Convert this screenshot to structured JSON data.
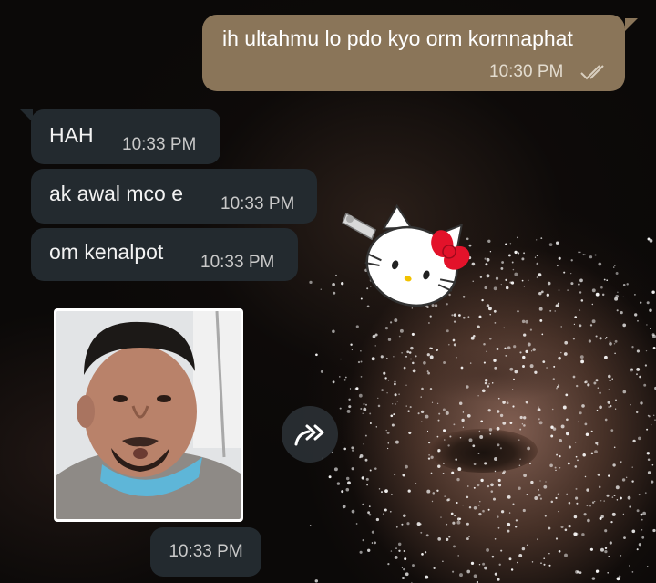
{
  "messages": [
    {
      "direction": "outgoing",
      "text": "ih ultahmu lo pdo kyo orm kornnaphat",
      "time": "10:30 PM",
      "status_icon": "double-check-icon"
    },
    {
      "direction": "incoming",
      "text": "HAH",
      "time": "10:33 PM"
    },
    {
      "direction": "incoming",
      "text": "ak awal mco e",
      "time": "10:33 PM"
    },
    {
      "direction": "incoming",
      "text": "om kenalpot",
      "time": "10:33 PM"
    }
  ],
  "image_message": {
    "type": "sticker-photo",
    "time": "10:33 PM",
    "forward_icon": "forward-arrows-icon"
  },
  "wallpaper": {
    "sticker_icon": "hello-kitty-hairclip-icon"
  },
  "colors": {
    "outgoing_bubble": "#8a7559",
    "incoming_bubble": "#232a2f",
    "time_text": "#c9c9c9"
  }
}
